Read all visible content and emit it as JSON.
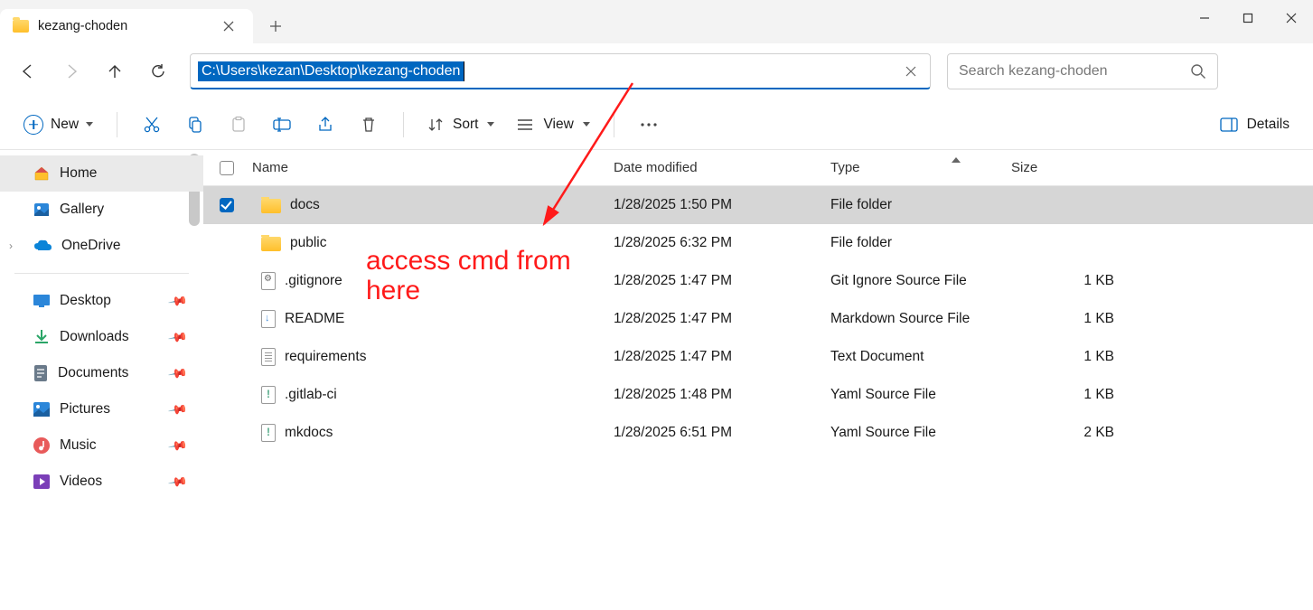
{
  "window": {
    "tab_title": "kezang-choden",
    "minimize_glyph": "—",
    "maximize_glyph": "▢",
    "close_glyph": "✕"
  },
  "nav": {
    "address_path": "C:\\Users\\kezan\\Desktop\\kezang-choden",
    "search_placeholder": "Search kezang-choden"
  },
  "toolbar": {
    "new_label": "New",
    "sort_label": "Sort",
    "view_label": "View",
    "details_label": "Details"
  },
  "sidebar": {
    "home": "Home",
    "gallery": "Gallery",
    "onedrive": "OneDrive",
    "desktop": "Desktop",
    "downloads": "Downloads",
    "documents": "Documents",
    "pictures": "Pictures",
    "music": "Music",
    "videos": "Videos"
  },
  "columns": {
    "name": "Name",
    "date": "Date modified",
    "type": "Type",
    "size": "Size"
  },
  "files": [
    {
      "name": "docs",
      "date": "1/28/2025 1:50 PM",
      "type": "File folder",
      "size": "",
      "icon": "folder",
      "selected": true
    },
    {
      "name": "public",
      "date": "1/28/2025 6:32 PM",
      "type": "File folder",
      "size": "",
      "icon": "folder",
      "selected": false
    },
    {
      "name": ".gitignore",
      "date": "1/28/2025 1:47 PM",
      "type": "Git Ignore Source File",
      "size": "1 KB",
      "icon": "gear",
      "selected": false
    },
    {
      "name": "README",
      "date": "1/28/2025 1:47 PM",
      "type": "Markdown Source File",
      "size": "1 KB",
      "icon": "md",
      "selected": false
    },
    {
      "name": "requirements",
      "date": "1/28/2025 1:47 PM",
      "type": "Text Document",
      "size": "1 KB",
      "icon": "txt",
      "selected": false
    },
    {
      "name": ".gitlab-ci",
      "date": "1/28/2025 1:48 PM",
      "type": "Yaml Source File",
      "size": "1 KB",
      "icon": "yml",
      "selected": false
    },
    {
      "name": "mkdocs",
      "date": "1/28/2025 6:51 PM",
      "type": "Yaml Source File",
      "size": "2 KB",
      "icon": "yml",
      "selected": false
    }
  ],
  "annotation": {
    "line1": "access cmd from",
    "line2": "here"
  }
}
